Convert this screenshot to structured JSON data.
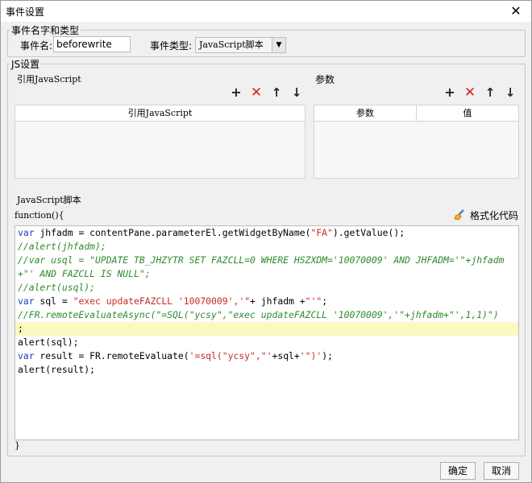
{
  "window": {
    "title": "事件设置",
    "close_glyph": "✕"
  },
  "event_group": {
    "legend": "事件名字和类型",
    "name_label": "事件名:",
    "name_value": "beforewrite",
    "type_label": "事件类型:",
    "type_value": "JavaScript脚本"
  },
  "js_group": {
    "legend": "JS设置",
    "ref_section": {
      "label": "引用JavaScript",
      "column": "引用JavaScript"
    },
    "params_section": {
      "label": "参数",
      "columns": [
        "参数",
        "值"
      ]
    },
    "icons": {
      "add": "+",
      "delete": "✕",
      "up": "🡑",
      "down": "🡓"
    }
  },
  "script": {
    "label": "JavaScript脚本",
    "header": "function(){",
    "footer": "}",
    "format_button": "格式化代码",
    "highlighted_line": 7,
    "lines": [
      "var jhfadm = contentPane.parameterEl.getWidgetByName(\"FA\").getValue();",
      "//alert(jhfadm);",
      "//var usql = \"UPDATE TB_JHZYTR SET FAZCLL=0 WHERE HSZXDM='10070009' AND JHFADM='\"+jhfadm",
      "+\"' AND FAZCLL IS NULL\";",
      "//alert(usql);",
      "var sql = \"exec updateFAZCLL '10070009','\"+ jhfadm +\"'\";",
      "//FR.remoteEvaluateAsync(\"=SQL(\"ycsy\",\"exec updateFAZCLL '10070009','\"+jhfadm+\"',1,1)\")",
      ";",
      "alert(sql);",
      "var result = FR.remoteEvaluate('=sql(\"ycsy\",\"'+sql+'\")');",
      "alert(result);"
    ]
  },
  "footer": {
    "ok": "确定",
    "cancel": "取消"
  },
  "colors": {
    "keyword": "#1a3ec8",
    "string": "#c82a2a",
    "comment": "#2e8b2e",
    "highlight": "#fafac0",
    "delete_icon": "#e02020"
  }
}
